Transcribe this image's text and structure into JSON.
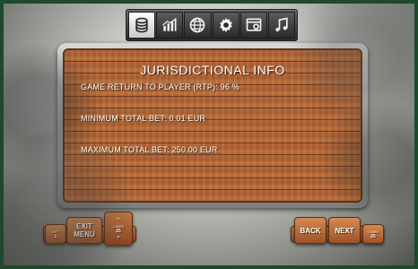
{
  "tabs": [
    {
      "icon": "coins-stack-icon",
      "active": true
    },
    {
      "icon": "bar-chart-icon",
      "active": false
    },
    {
      "icon": "globe-icon",
      "active": false
    },
    {
      "icon": "gear-icon",
      "active": false
    },
    {
      "icon": "window-settings-icon",
      "active": false
    },
    {
      "icon": "music-note-icon",
      "active": false
    }
  ],
  "panel": {
    "title": "JURISDICTIONAL INFO",
    "lines": [
      "GAME RETURN TO PLAYER (RTP): 96 %",
      "MINIMUM TOTAL BET: 0.01 EUR",
      "MAXIMUM TOTAL BET: 250.00 EUR"
    ]
  },
  "controls": {
    "bet_label": "BET",
    "bet_value": "1",
    "exit_menu_label": [
      "EXIT",
      "MENU"
    ],
    "lines_label": "LINES",
    "lines_value": "25",
    "back_label": "BACK",
    "next_label": "NEXT",
    "lines_right_label": "LINES",
    "lines_right_value": "25"
  },
  "colors": {
    "frame_border": "#1d4a2c",
    "wood": "#b7693a",
    "text": "#ffffff"
  }
}
